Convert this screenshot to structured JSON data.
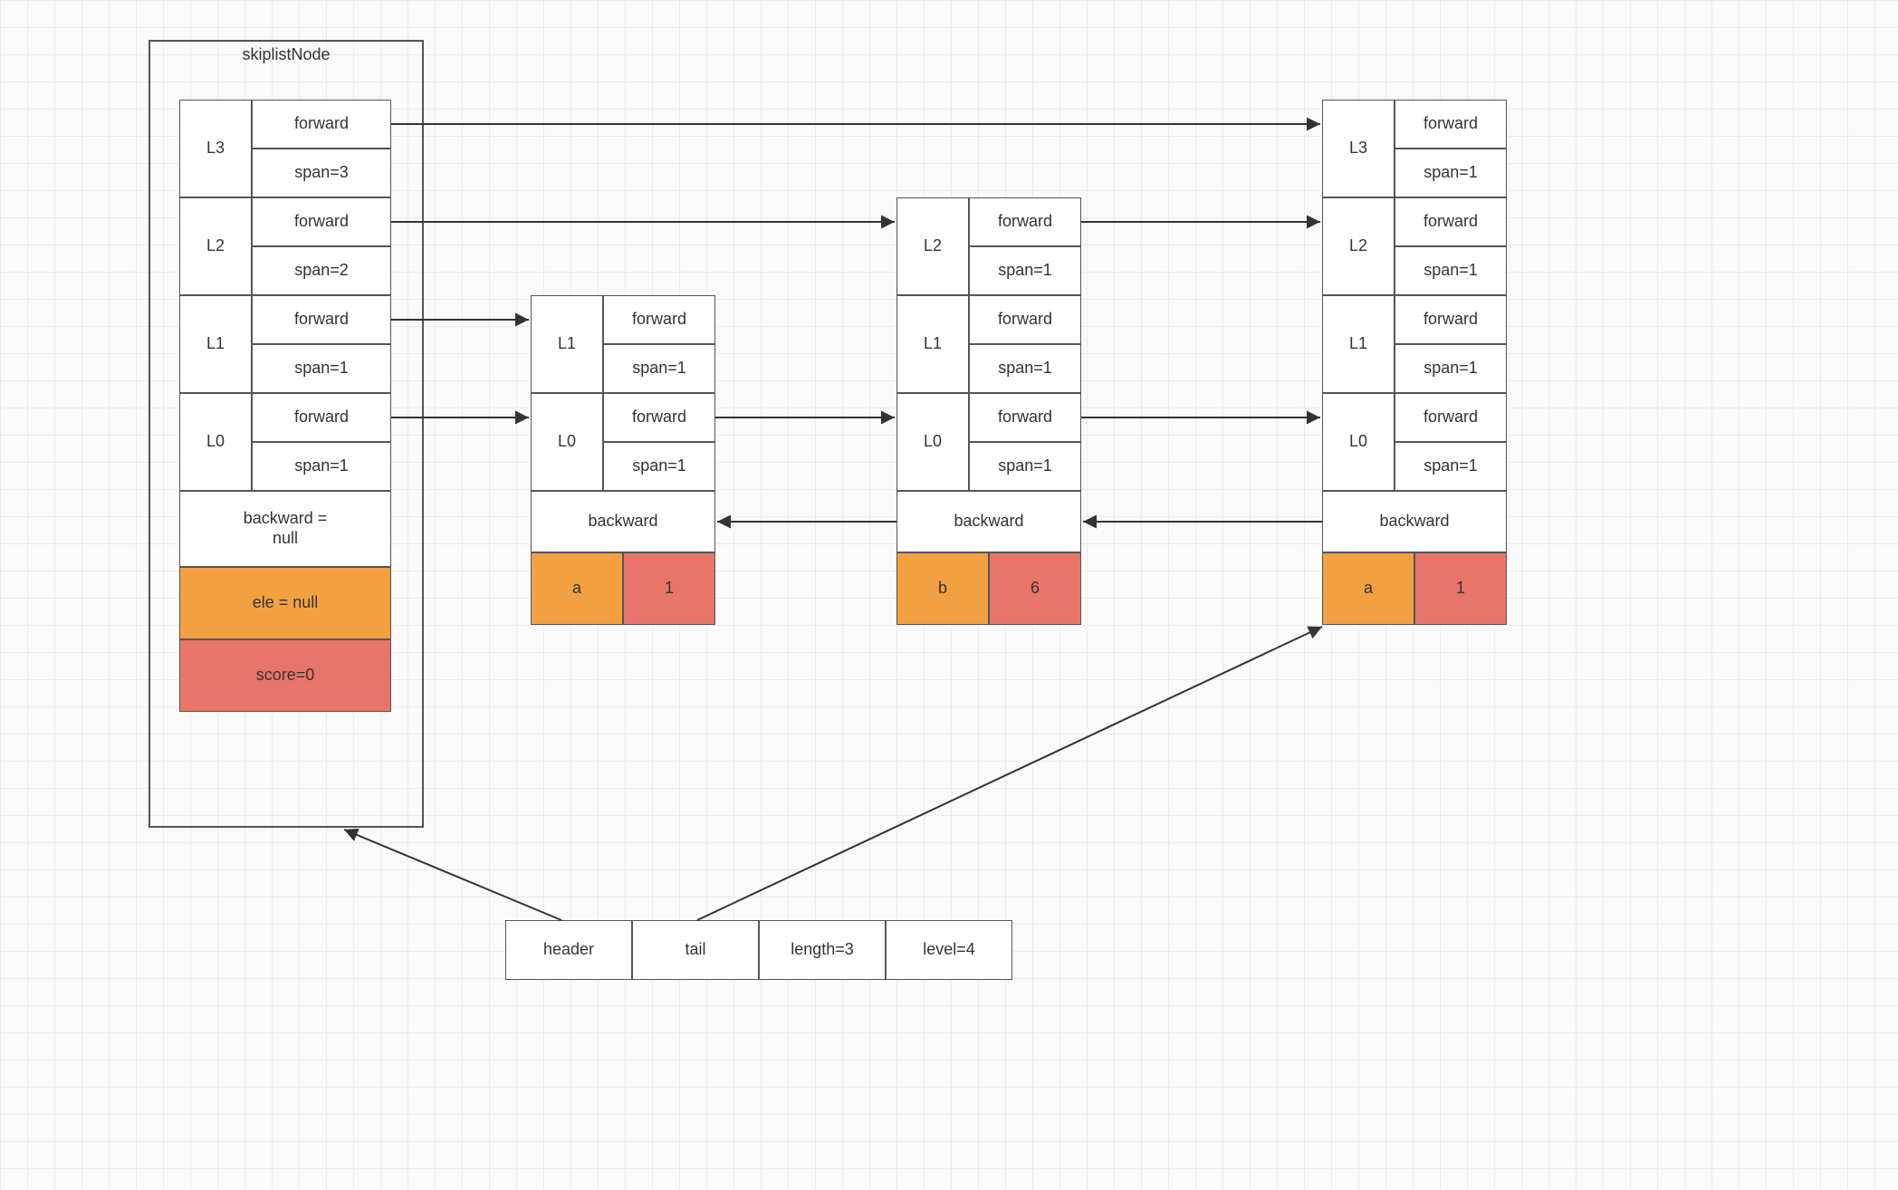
{
  "title": "skiplistNode",
  "labels": {
    "forward": "forward",
    "backward": "backward",
    "backward_null": "backward =\nnull",
    "L0": "L0",
    "L1": "L1",
    "L2": "L2",
    "L3": "L3",
    "ele_null": "ele = null",
    "score0": "score=0"
  },
  "spans": {
    "s1": "span=1",
    "s2": "span=2",
    "s3": "span=3"
  },
  "meta": {
    "header": "header",
    "tail": "tail",
    "length": "length=3",
    "level": "level=4"
  },
  "header_node": {
    "levels": [
      {
        "name": "L3",
        "forward": "forward",
        "span": "span=3"
      },
      {
        "name": "L2",
        "forward": "forward",
        "span": "span=2"
      },
      {
        "name": "L1",
        "forward": "forward",
        "span": "span=1"
      },
      {
        "name": "L0",
        "forward": "forward",
        "span": "span=1"
      }
    ],
    "backward": "backward =\nnull",
    "ele": "ele = null",
    "score": "score=0"
  },
  "nodes": [
    {
      "ele": "a",
      "score": "1",
      "levels": [
        "L1",
        "L0"
      ]
    },
    {
      "ele": "b",
      "score": "6",
      "levels": [
        "L2",
        "L1",
        "L0"
      ]
    },
    {
      "ele": "a",
      "score": "1",
      "levels": [
        "L3",
        "L2",
        "L1",
        "L0"
      ]
    }
  ]
}
